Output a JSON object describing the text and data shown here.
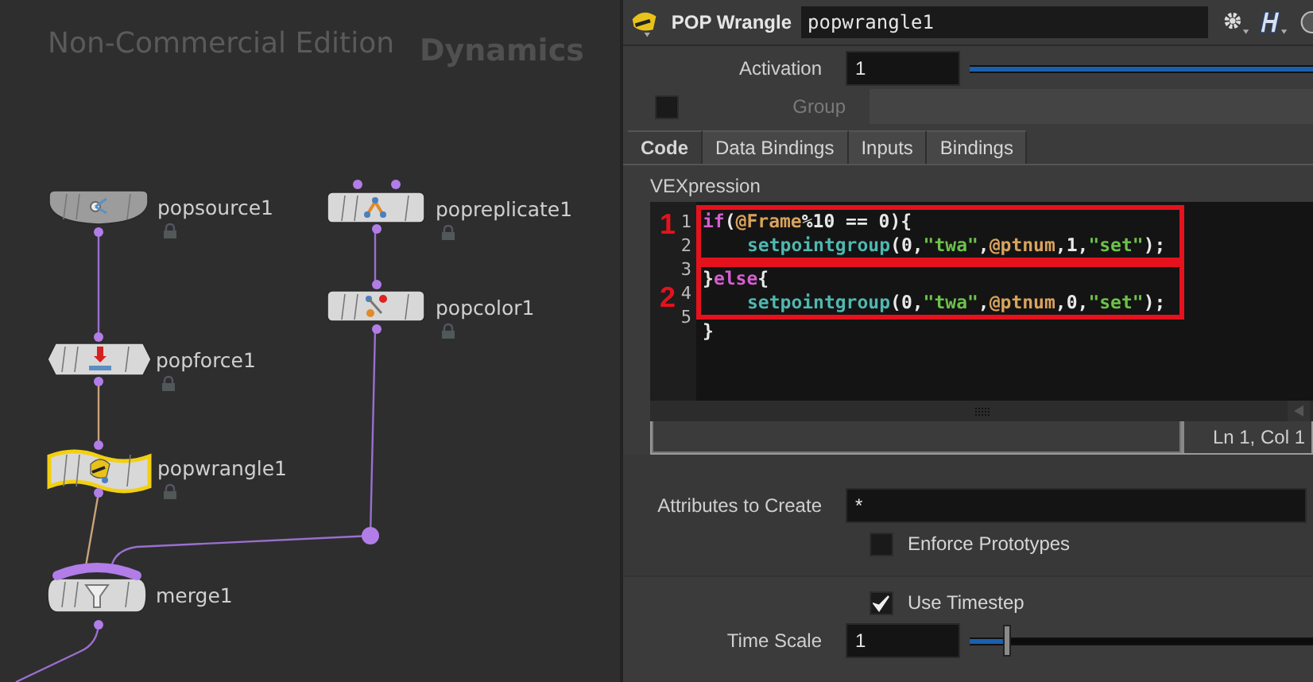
{
  "network": {
    "watermark": "Non-Commercial Edition",
    "context": "Dynamics",
    "nodes": [
      {
        "name": "popsource1",
        "kind": "source",
        "selected": false,
        "locked": true
      },
      {
        "name": "popreplicate1",
        "kind": "replicate",
        "selected": false,
        "locked": true
      },
      {
        "name": "popcolor1",
        "kind": "color",
        "selected": false,
        "locked": true
      },
      {
        "name": "popforce1",
        "kind": "force",
        "selected": false,
        "locked": true
      },
      {
        "name": "popwrangle1",
        "kind": "wrangle",
        "selected": true,
        "locked": true
      },
      {
        "name": "merge1",
        "kind": "merge",
        "selected": false,
        "locked": false
      }
    ]
  },
  "header": {
    "type_label": "POP Wrangle",
    "node_name": "popwrangle1"
  },
  "params_top": [
    {
      "kind": "slider",
      "label": "Activation",
      "value": "1",
      "level": 1
    },
    {
      "kind": "toggle_field",
      "label": "Group",
      "checked": false,
      "disabled": true
    }
  ],
  "tabs": [
    {
      "label": "Code",
      "selected": true
    },
    {
      "label": "Data Bindings",
      "selected": false
    },
    {
      "label": "Inputs",
      "selected": false
    },
    {
      "label": "Bindings",
      "selected": false
    }
  ],
  "editor": {
    "label": "VEXpression",
    "status": "Ln 1, Col 1",
    "blocks": [
      {
        "mark": "1",
        "lines": [
          {
            "number": "1",
            "indented": false,
            "tokens": [
              {
                "color": "#d65fd0",
                "text": "if"
              },
              {
                "color": "#e8e8e8",
                "text": "("
              },
              {
                "color": "#d9a35c",
                "text": "@Frame"
              },
              {
                "color": "#e8e8e8",
                "text": "%10 == 0){"
              }
            ]
          },
          {
            "number": "2",
            "indented": true,
            "tokens": [
              {
                "color": "#4fb8b0",
                "text": "setpointgroup"
              },
              {
                "color": "#e8e8e8",
                "text": "(0,"
              },
              {
                "color": "#6cc24a",
                "text": "\"twa\""
              },
              {
                "color": "#e8e8e8",
                "text": ","
              },
              {
                "color": "#d9a35c",
                "text": "@ptnum"
              },
              {
                "color": "#e8e8e8",
                "text": ",1,"
              },
              {
                "color": "#6cc24a",
                "text": "\"set\""
              },
              {
                "color": "#e8e8e8",
                "text": ");"
              }
            ]
          }
        ]
      },
      {
        "mark": "2",
        "lines": [
          {
            "number": "3",
            "indented": false,
            "tokens": [
              {
                "color": "#e8e8e8",
                "text": "}"
              },
              {
                "color": "#d65fd0",
                "text": "else"
              },
              {
                "color": "#e8e8e8",
                "text": "{"
              }
            ]
          },
          {
            "number": "4",
            "indented": true,
            "tokens": [
              {
                "color": "#4fb8b0",
                "text": "setpointgroup"
              },
              {
                "color": "#e8e8e8",
                "text": "(0,"
              },
              {
                "color": "#6cc24a",
                "text": "\"twa\""
              },
              {
                "color": "#e8e8e8",
                "text": ","
              },
              {
                "color": "#d9a35c",
                "text": "@ptnum"
              },
              {
                "color": "#e8e8e8",
                "text": ",0,"
              },
              {
                "color": "#6cc24a",
                "text": "\"set\""
              },
              {
                "color": "#e8e8e8",
                "text": ");"
              }
            ]
          }
        ]
      },
      {
        "lines": [
          {
            "number": "5",
            "indented": false,
            "tokens": [
              {
                "color": "#e8e8e8",
                "text": "}"
              }
            ]
          }
        ]
      }
    ]
  },
  "sections": [
    {
      "shaded": true,
      "params": [
        {
          "kind": "text",
          "label": "Attributes to Create",
          "value": "*"
        },
        {
          "kind": "toggle",
          "label": "Enforce Prototypes",
          "checked": false
        }
      ]
    },
    {
      "shaded": false,
      "params": [
        {
          "kind": "toggle",
          "label": "Use Timestep",
          "checked": true
        },
        {
          "kind": "slider",
          "label": "Time Scale",
          "value": "1",
          "level": 0.11
        }
      ]
    }
  ]
}
